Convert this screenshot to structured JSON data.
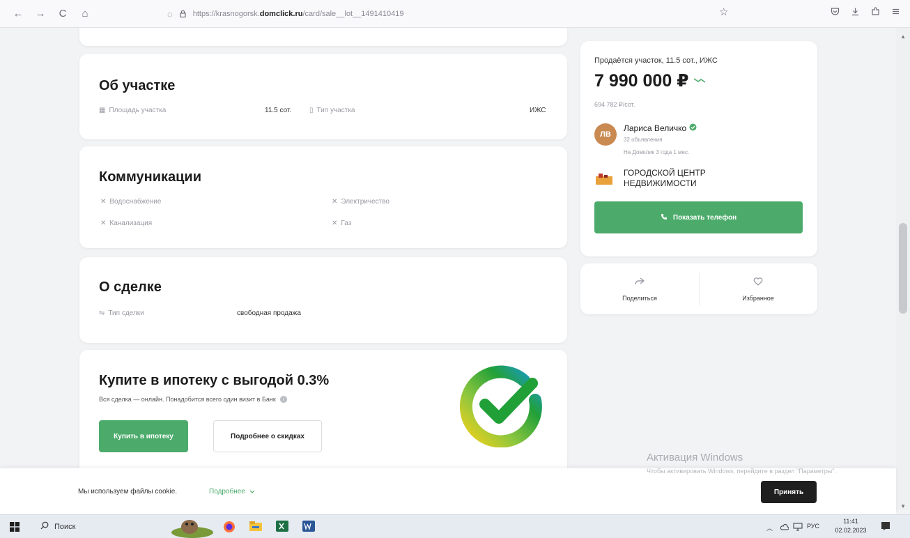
{
  "browser": {
    "url_prefix": "https://krasnogorsk.",
    "url_domain": "domclick.ru",
    "url_suffix": "/card/sale__lot__1491410419",
    "back_icon": "←",
    "forward_icon": "→",
    "reload_icon": "C",
    "home_icon": "⌂",
    "shield_icon": "◌",
    "lock_icon": "🔒",
    "star_icon": "☆"
  },
  "plot": {
    "title": "Об участке",
    "area_label": "Площадь участка",
    "area_value": "11.5 сот.",
    "type_label": "Тип участка",
    "type_value": "ИЖС"
  },
  "communications": {
    "title": "Коммуникации",
    "items": [
      "Водоснабжение",
      "Электричество",
      "Канализация",
      "Газ"
    ]
  },
  "deal": {
    "title": "О сделке",
    "type_label": "Тип сделки",
    "type_value": "свободная продажа"
  },
  "mortgage": {
    "title": "Купите в ипотеку с выгодой 0.3%",
    "subtitle": "Вся сделка — онлайн. Понадобится всего один визит в Банк",
    "buy_button": "Купить в ипотеку",
    "details_button": "Подробнее о скидках"
  },
  "listing": {
    "title": "Продаётся участок, 11.5 сот., ИЖС",
    "price": "7 990 000 ₽",
    "price_per_unit": "694 782 ₽/сот.",
    "agent_initials": "ЛВ",
    "agent_name": "Лариса Величко",
    "agent_listings": "32 объявления",
    "agent_tenure": "На Домклик 3 года 1 мес.",
    "agency_name_line1": "ГОРОДСКОЙ ЦЕНТР",
    "agency_name_line2": "НЕДВИЖИМОСТИ",
    "show_phone_button": "Показать телефон"
  },
  "actions": {
    "share_label": "Поделиться",
    "favorite_label": "Избранное"
  },
  "cookie": {
    "text": "Мы используем файлы cookie.",
    "more_link": "Подробнее",
    "accept_button": "Принять"
  },
  "watermark": {
    "title": "Активация Windows",
    "text": "Чтобы активировать Windows, перейдите в раздел \"Параметры\"."
  },
  "taskbar": {
    "search_placeholder": "Поиск",
    "lang": "РУС",
    "time": "11:41",
    "date": "02.02.2023"
  },
  "colors": {
    "accent_green": "#4cab6b",
    "agent_avatar": "#c98a52"
  }
}
